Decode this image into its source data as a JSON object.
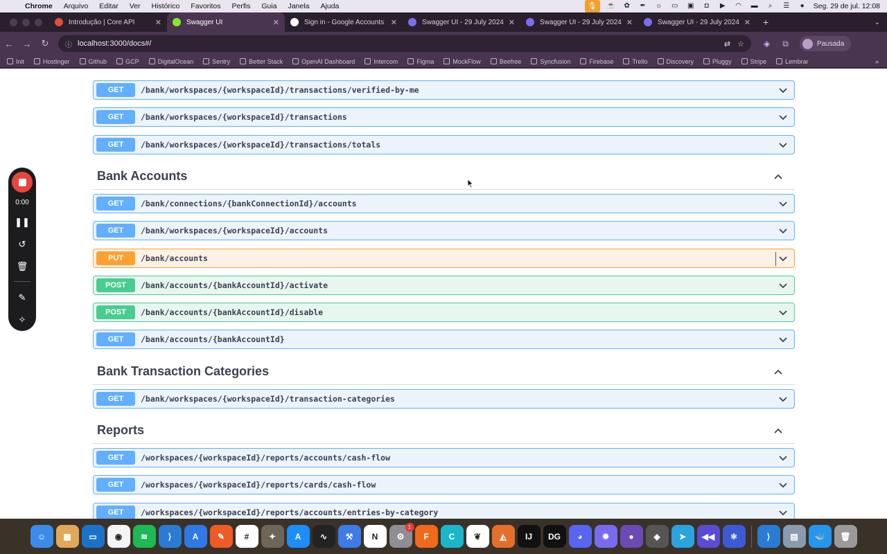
{
  "menubar": {
    "app": "Chrome",
    "items": [
      "Arquivo",
      "Editar",
      "Ver",
      "Histórico",
      "Favoritos",
      "Perfis",
      "Guia",
      "Janela",
      "Ajuda"
    ],
    "clock": "Seg. 29 de jul.  12:08"
  },
  "tabs": [
    {
      "title": "Introdução | Core API",
      "color": "#e04e39"
    },
    {
      "title": "Swagger UI",
      "color": "#85ea2d"
    },
    {
      "title": "Sign in - Google Accounts",
      "color": "#ffffff"
    },
    {
      "title": "Swagger UI - 29 July 2024",
      "color": "#7c6df0"
    },
    {
      "title": "Swagger UI - 29 July 2024",
      "color": "#7c6df0"
    },
    {
      "title": "Swagger UI - 29 July 2024",
      "color": "#7c6df0"
    }
  ],
  "toolbar": {
    "url": "localhost:3000/docs#/",
    "profile_label": "Pausada"
  },
  "bookmarks": [
    "Init",
    "Hostinger",
    "Github",
    "GCP",
    "DigitalOcean",
    "Sentry",
    "Better Stack",
    "OpenAI Dashboard",
    "Intercom",
    "Figma",
    "MockFlow",
    "Beefree",
    "Syncfusion",
    "Firebase",
    "Trello",
    "Discovery",
    "Pluggy",
    "Stripe",
    "Lembrar"
  ],
  "operations_top": [
    {
      "method": "GET",
      "path": "/bank/workspaces/{workspaceId}/transactions/verified-by-me"
    },
    {
      "method": "GET",
      "path": "/bank/workspaces/{workspaceId}/transactions"
    },
    {
      "method": "GET",
      "path": "/bank/workspaces/{workspaceId}/transactions/totals"
    }
  ],
  "sections": [
    {
      "title": "Bank Accounts",
      "operations": [
        {
          "method": "GET",
          "path": "/bank/connections/{bankConnectionId}/accounts"
        },
        {
          "method": "GET",
          "path": "/bank/workspaces/{workspaceId}/accounts"
        },
        {
          "method": "PUT",
          "path": "/bank/accounts"
        },
        {
          "method": "POST",
          "path": "/bank/accounts/{bankAccountId}/activate"
        },
        {
          "method": "POST",
          "path": "/bank/accounts/{bankAccountId}/disable"
        },
        {
          "method": "GET",
          "path": "/bank/accounts/{bankAccountId}"
        }
      ]
    },
    {
      "title": "Bank Transaction Categories",
      "operations": [
        {
          "method": "GET",
          "path": "/bank/workspaces/{workspaceId}/transaction-categories"
        }
      ]
    },
    {
      "title": "Reports",
      "operations": [
        {
          "method": "GET",
          "path": "/workspaces/{workspaceId}/reports/accounts/cash-flow"
        },
        {
          "method": "GET",
          "path": "/workspaces/{workspaceId}/reports/cards/cash-flow"
        },
        {
          "method": "GET",
          "path": "/workspaces/{workspaceId}/reports/accounts/entries-by-category"
        }
      ]
    }
  ],
  "recorder": {
    "timer": "0:00"
  },
  "dock": {
    "apps": [
      {
        "name": "finder",
        "color": "#3b8bea",
        "glyph": "☺"
      },
      {
        "name": "launchpad",
        "color": "#e0a85a",
        "glyph": "▦"
      },
      {
        "name": "terminal-app",
        "color": "#1a73c9",
        "glyph": "▭"
      },
      {
        "name": "chrome",
        "color": "#f4f4f4",
        "glyph": "◉"
      },
      {
        "name": "spotify",
        "color": "#1db954",
        "glyph": "≋"
      },
      {
        "name": "vscode",
        "color": "#2a7bd3",
        "glyph": "⟩"
      },
      {
        "name": "app-a",
        "color": "#2f78e6",
        "glyph": "A"
      },
      {
        "name": "postman",
        "color": "#ef5b25",
        "glyph": "✎"
      },
      {
        "name": "slack",
        "color": "#ffffff",
        "glyph": "#"
      },
      {
        "name": "gimp",
        "color": "#6e6658",
        "glyph": "✦"
      },
      {
        "name": "app-store",
        "color": "#1c8ef9",
        "glyph": "A"
      },
      {
        "name": "activity-monitor",
        "color": "#232323",
        "glyph": "∿"
      },
      {
        "name": "xcode-tools",
        "color": "#3d7be6",
        "glyph": "⚒"
      },
      {
        "name": "notion",
        "color": "#ffffff",
        "glyph": "N"
      },
      {
        "name": "system-settings",
        "color": "#8e8e93",
        "glyph": "⚙",
        "badge": "1"
      },
      {
        "name": "fusion",
        "color": "#f06a1d",
        "glyph": "F"
      },
      {
        "name": "capcut",
        "color": "#1bb6c9",
        "glyph": "C"
      },
      {
        "name": "mongodb",
        "color": "#ffffff",
        "glyph": "❦"
      },
      {
        "name": "matlab",
        "color": "#e46f2c",
        "glyph": "◭"
      },
      {
        "name": "intellij",
        "color": "#111111",
        "glyph": "IJ"
      },
      {
        "name": "datagrip",
        "color": "#111111",
        "glyph": "DG"
      },
      {
        "name": "discord",
        "color": "#5865f2",
        "glyph": "◕"
      },
      {
        "name": "app-gear",
        "color": "#7a6af0",
        "glyph": "✹"
      },
      {
        "name": "app-circle",
        "color": "#6c4ab6",
        "glyph": "●"
      },
      {
        "name": "unity",
        "color": "#555555",
        "glyph": "◈"
      },
      {
        "name": "telegram",
        "color": "#2aa3e0",
        "glyph": "➤"
      },
      {
        "name": "app-rewind",
        "color": "#5b4bd6",
        "glyph": "◀◀"
      },
      {
        "name": "app-atom",
        "color": "#3b5bd6",
        "glyph": "⚛"
      }
    ],
    "right_apps": [
      {
        "name": "vscode-2",
        "color": "#2a7bd3",
        "glyph": "⟩"
      },
      {
        "name": "disk-utility",
        "color": "#8a9bb0",
        "glyph": "▤"
      },
      {
        "name": "docker",
        "color": "#2496ed",
        "glyph": "🐳"
      }
    ],
    "trash": {
      "name": "trash",
      "color": "#9a9a9a",
      "glyph": "🗑"
    }
  }
}
